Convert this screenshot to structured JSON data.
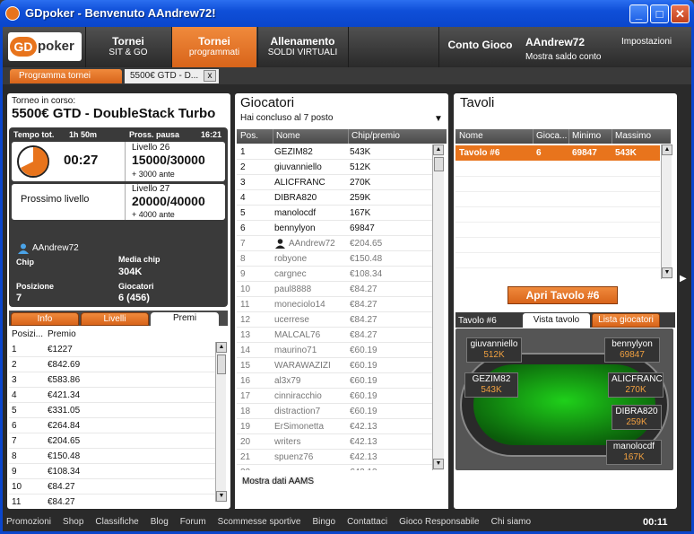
{
  "window": {
    "title": "GDpoker - Benvenuto AAndrew72!"
  },
  "nav": {
    "logo_gd": "GD",
    "logo_poker": "poker",
    "items": [
      {
        "l1": "Tornei",
        "l2": "SIT & GO"
      },
      {
        "l1": "Tornei",
        "l2": "programmati"
      },
      {
        "l1": "Allenamento",
        "l2": "SOLDI VIRTUALI"
      },
      {
        "l1": "",
        "l2": ""
      },
      {
        "l1": "Conto Gioco",
        "l2": ""
      }
    ],
    "user": "AAndrew72",
    "settings": "Impostazioni",
    "balance_link": "Mostra saldo conto"
  },
  "tabs": {
    "schedule": "Programma tornei",
    "current": "5500€ GTD - D...",
    "close": "x"
  },
  "tournament": {
    "label": "Torneo in corso:",
    "name": "5500€ GTD - DoubleStack Turbo",
    "total_time_label": "Tempo tot.",
    "total_time": "1h 50m",
    "next_break_label": "Pross. pausa",
    "next_break": "16:21",
    "clock": "00:27",
    "level": "Livello 26",
    "blinds": "15000/30000",
    "ante": "+ 3000 ante",
    "next_label": "Prossimo livello",
    "next_level": "Livello 27",
    "next_blinds": "20000/40000",
    "next_ante": "+ 4000 ante",
    "player": "AAndrew72",
    "chip_label": "Chip",
    "avg_label": "Media chip",
    "avg": "304K",
    "pos_label": "Posizione",
    "pos": "7",
    "players_label": "Giocatori",
    "players": "6 (456)"
  },
  "left_tabs": [
    "Info",
    "Livelli",
    "Premi"
  ],
  "prizes": {
    "headers": [
      "Posizi...",
      "Premio"
    ],
    "rows": [
      [
        "1",
        "€1227"
      ],
      [
        "2",
        "€842.69"
      ],
      [
        "3",
        "€583.86"
      ],
      [
        "4",
        "€421.34"
      ],
      [
        "5",
        "€331.05"
      ],
      [
        "6",
        "€264.84"
      ],
      [
        "7",
        "€204.65"
      ],
      [
        "8",
        "€150.48"
      ],
      [
        "9",
        "€108.34"
      ],
      [
        "10",
        "€84.27"
      ],
      [
        "11",
        "€84.27"
      ]
    ]
  },
  "players": {
    "title": "Giocatori",
    "subtitle": "Hai concluso al 7 posto",
    "headers": [
      "Pos.",
      "Nome",
      "Chip/premio"
    ],
    "rows": [
      [
        "1",
        "GEZIM82",
        "543K"
      ],
      [
        "2",
        "giuvanniello",
        "512K"
      ],
      [
        "3",
        "ALICFRANC",
        "270K"
      ],
      [
        "4",
        "DIBRA820",
        "259K"
      ],
      [
        "5",
        "manolocdf",
        "167K"
      ],
      [
        "6",
        "bennylyon",
        "69847"
      ],
      [
        "7",
        "AAndrew72",
        "€204.65"
      ],
      [
        "8",
        "robyone",
        "€150.48"
      ],
      [
        "9",
        "cargnec",
        "€108.34"
      ],
      [
        "10",
        "paul8888",
        "€84.27"
      ],
      [
        "11",
        "moneciolo14",
        "€84.27"
      ],
      [
        "12",
        "ucerrese",
        "€84.27"
      ],
      [
        "13",
        "MALCAL76",
        "€84.27"
      ],
      [
        "14",
        "maurino71",
        "€60.19"
      ],
      [
        "15",
        "WARAWAZIZI",
        "€60.19"
      ],
      [
        "16",
        "al3x79",
        "€60.19"
      ],
      [
        "17",
        "cinniracchio",
        "€60.19"
      ],
      [
        "18",
        "distraction7",
        "€60.19"
      ],
      [
        "19",
        "ErSimonetta",
        "€42.13"
      ],
      [
        "20",
        "writers",
        "€42.13"
      ],
      [
        "21",
        "spuenz76",
        "€42.13"
      ],
      [
        "22",
        "...",
        "€42.13"
      ]
    ],
    "aams": "Mostra dati AAMS"
  },
  "tables": {
    "title": "Tavoli",
    "headers": [
      "Nome",
      "Gioca...",
      "Minimo",
      "Massimo"
    ],
    "rows": [
      [
        "Tavolo #6",
        "6",
        "69847",
        "543K"
      ]
    ],
    "open_btn": "Apri Tavolo #6",
    "tabs": [
      "Tavolo #6",
      "Vista tavolo",
      "Lista giocatori"
    ],
    "seats": [
      {
        "name": "giuvanniello",
        "chips": "512K"
      },
      {
        "name": "bennylyon",
        "chips": "69847"
      },
      {
        "name": "GEZIM82",
        "chips": "543K"
      },
      {
        "name": "ALICFRANC",
        "chips": "270K"
      },
      {
        "name": "DIBRA820",
        "chips": "259K"
      },
      {
        "name": "manolocdf",
        "chips": "167K"
      }
    ]
  },
  "footer": {
    "links": [
      "Promozioni",
      "Shop",
      "Classifiche",
      "Blog",
      "Forum",
      "Scommesse sportive",
      "Bingo",
      "Contattaci",
      "Gioco Responsabile",
      "Chi siamo"
    ],
    "clock": "00:11"
  }
}
